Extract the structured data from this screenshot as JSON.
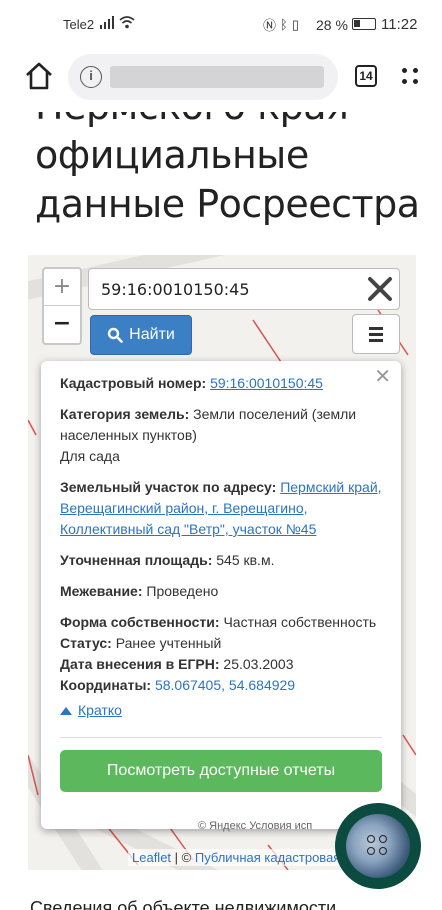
{
  "statusbar": {
    "carrier": "Tele2",
    "battery_percent": "28 %",
    "time": "11:22",
    "icons": [
      "nfc-icon",
      "bluetooth-icon",
      "vibrate-icon"
    ]
  },
  "browser": {
    "tabs_count": "14",
    "url_hidden": true
  },
  "heading": {
    "line1": "Пермского края",
    "line2": "официальные",
    "line3": "данные Росреестра"
  },
  "map": {
    "search_value": "59:16:0010150:45",
    "find_label": "Найти",
    "zoom_in": "+",
    "zoom_out": "−",
    "attribution_leaflet": "Leaflet",
    "attribution_sep": " | © ",
    "attribution_source": "Публичная кадастровая",
    "yandex_text": "© Яндекс  Условия исп"
  },
  "popup": {
    "cadastral_label": "Кадастровый номер:",
    "cadastral_value": "59:16:0010150:45",
    "category_label": "Категория земель:",
    "category_value": "Земли поселений (земли населенных пунктов)",
    "purpose": "Для сада",
    "address_label": "Земельный участок по адресу:",
    "address_value": "Пермский край, Верещагинский район, г. Верещагино, Коллективный сад \"Ветр\", участок №45",
    "area_label": "Уточненная площадь:",
    "area_value": "545 кв.м.",
    "survey_label": "Межевание:",
    "survey_value": "Проведено",
    "ownership_label": "Форма собственности:",
    "ownership_value": "Частная собственность",
    "status_label": "Статус:",
    "status_value": "Ранее учтенный",
    "egrn_label": "Дата внесения в ЕГРН:",
    "egrn_value": "25.03.2003",
    "coords_label": "Координаты:",
    "coords_value": "58.067405, 54.684929",
    "brief_label": "Кратко",
    "reports_button": "Посмотреть доступные отчеты"
  },
  "bottom_text": "Сведения об объекте недвижимости",
  "colors": {
    "find_button": "#3b7fc4",
    "reports_button": "#5cb85c",
    "link": "#2a74c4",
    "fab": "#0c4c40"
  }
}
